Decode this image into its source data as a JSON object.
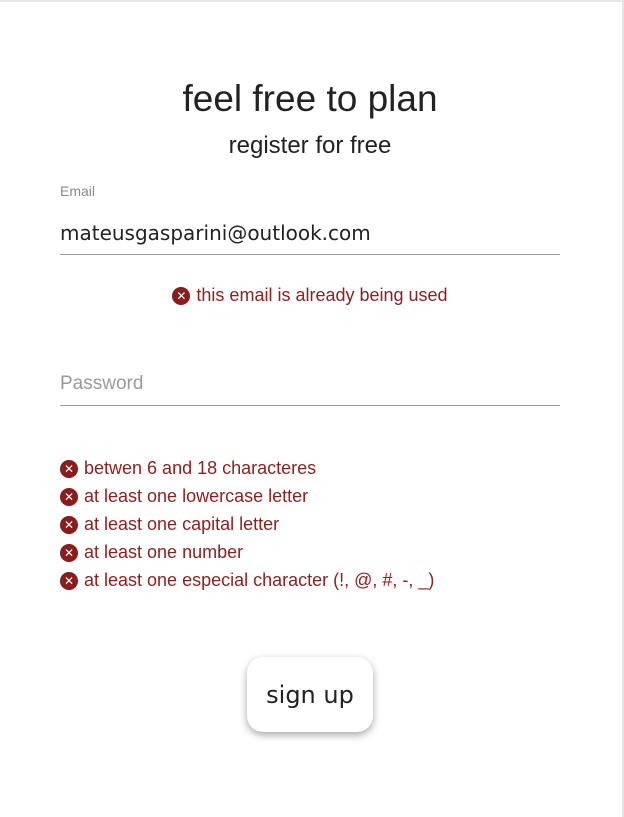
{
  "header": {
    "title": "feel free to plan",
    "subtitle": "register for free"
  },
  "email": {
    "label": "Email",
    "value": "mateusgasparini@outlook.com",
    "error": "this email is already being used"
  },
  "password": {
    "placeholder": "Password",
    "value": ""
  },
  "password_rules": [
    "betwen 6 and 18 characteres",
    "at least one lowercase letter",
    "at least one capital letter",
    "at least one number",
    "at least one especial character (!, @, #, -, _)"
  ],
  "actions": {
    "signup_label": "sign up"
  },
  "icons": {
    "error": "error-circle-x-icon"
  },
  "colors": {
    "error": "#8b2222",
    "text": "#222222",
    "muted": "#8a8a8a"
  }
}
